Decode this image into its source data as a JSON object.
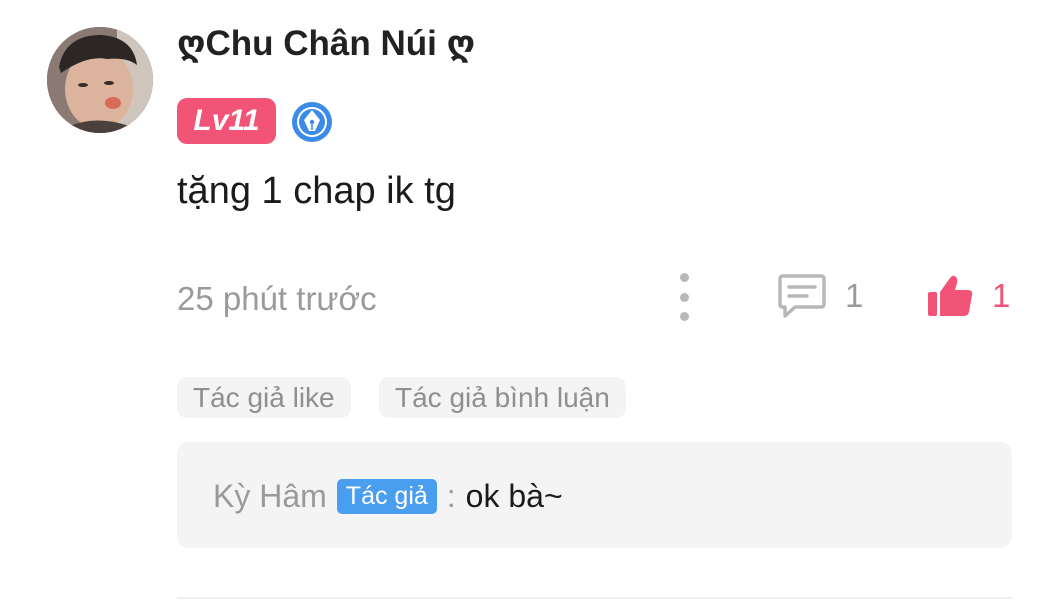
{
  "comment": {
    "username": "ღChu Chân Núi ღ",
    "level": "Lv11",
    "text": "tặng 1 chap ik tg",
    "time": "25 phút trước",
    "reply_count": "1",
    "like_count": "1"
  },
  "tags": [
    "Tác giả like",
    "Tác giả bình luận"
  ],
  "reply": {
    "name": "Kỳ Hâm",
    "badge": "Tác giả",
    "separator": ":",
    "text": "ok bà~"
  },
  "colors": {
    "accent_pink": "#f25478",
    "author_blue": "#4a9ef0",
    "muted_gray": "#9a9a9a"
  },
  "icons": {
    "pen": "pen-nib-icon",
    "more": "more-vertical-icon",
    "comment": "comment-icon",
    "like": "thumbs-up-icon"
  }
}
